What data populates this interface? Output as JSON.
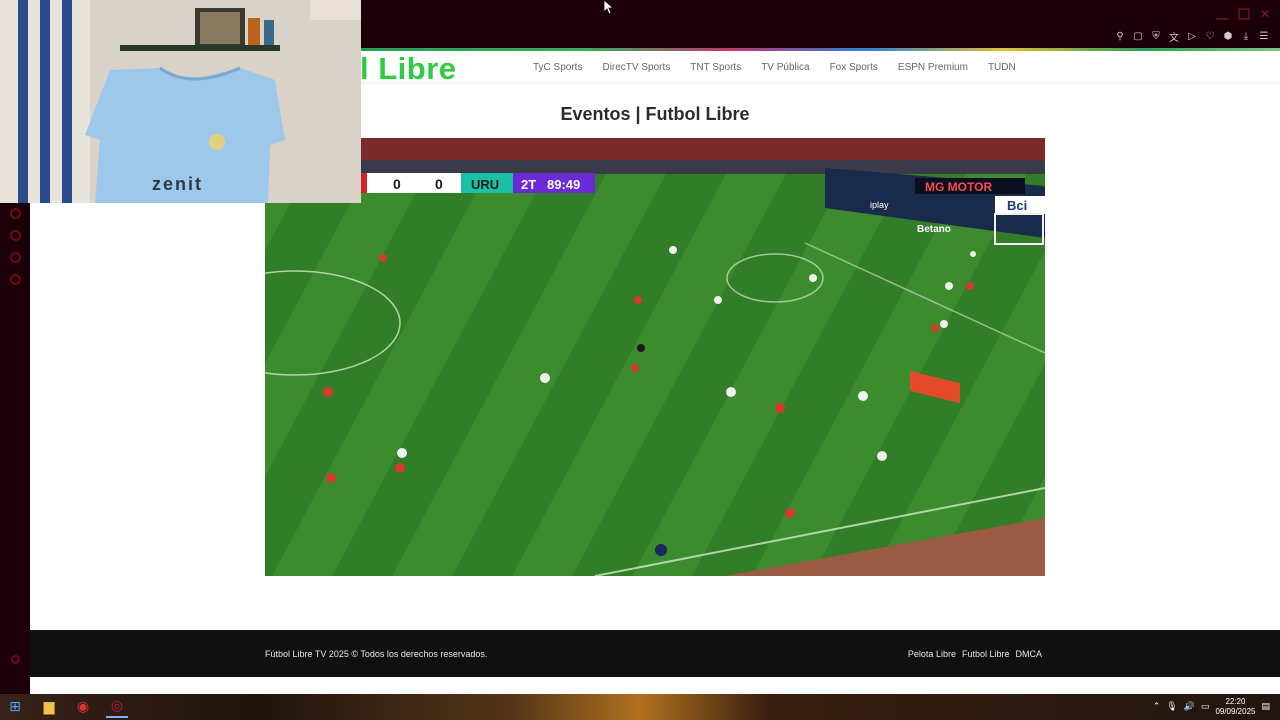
{
  "browser": {
    "toolbar_icons": [
      "pin-icon",
      "tab-icon",
      "shield-icon",
      "translate-icon",
      "play-icon",
      "heart-icon",
      "extension-icon",
      "download-icon",
      "menu-icon"
    ]
  },
  "site": {
    "logo": "l Libre",
    "nav": [
      "TyC Sports",
      "DirecTV Sports",
      "TNT Sports",
      "TV Pública",
      "Fox Sports",
      "ESPN Premium",
      "TUDN"
    ],
    "page_title": "Eventos | Futbol Libre"
  },
  "video": {
    "scorebug": {
      "home_score": "0",
      "away_score": "0",
      "away_team": "URU",
      "period": "2T",
      "clock": "89:49"
    },
    "boards": [
      "MG MOTOR",
      "Bci",
      "Betano",
      "iplay"
    ]
  },
  "webcam": {
    "shirt_brand": "zenit"
  },
  "footer": {
    "copyright": "Fútbol Libre TV 2025 © Todos los derechos reservados.",
    "links": [
      "Pelota Libre",
      "Futbol Libre",
      "DMCA"
    ]
  },
  "taskbar": {
    "time": "22:20",
    "date": "09/09/2025"
  },
  "colors": {
    "brand_green": "#2ecc40",
    "chrome_bg": "#1b0009",
    "footer_bg": "#101010",
    "scorebug_teal": "#19c2a4",
    "scorebug_purple": "#6a2bd6"
  }
}
